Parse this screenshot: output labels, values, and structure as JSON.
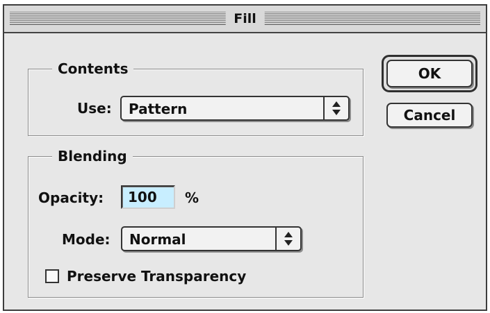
{
  "window": {
    "title": "Fill"
  },
  "contents": {
    "legend": "Contents",
    "use_label": "Use:",
    "use_value": "Pattern"
  },
  "blending": {
    "legend": "Blending",
    "opacity_label": "Opacity:",
    "opacity_value": "100",
    "opacity_unit": "%",
    "mode_label": "Mode:",
    "mode_value": "Normal",
    "preserve_transparency_label": "Preserve Transparency",
    "preserve_transparency_checked": false
  },
  "buttons": {
    "ok_label": "OK",
    "cancel_label": "Cancel"
  },
  "colors": {
    "dialog_background": "#e7e7e7",
    "input_highlight": "#c8eeff"
  },
  "icons": {
    "popup_arrows": "up-down-arrows-icon"
  }
}
